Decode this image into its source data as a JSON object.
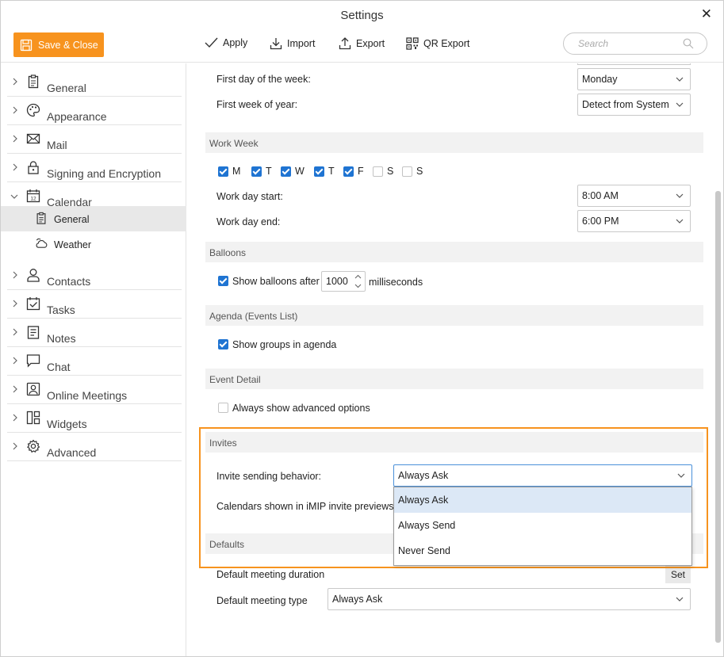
{
  "window": {
    "title": "Settings"
  },
  "toolbar": {
    "save_close": "Save & Close",
    "apply": "Apply",
    "import": "Import",
    "export": "Export",
    "qr_export": "QR Export",
    "search_placeholder": "Search"
  },
  "sidebar": {
    "items": [
      {
        "label": "General",
        "icon": "clipboard-icon"
      },
      {
        "label": "Appearance",
        "icon": "palette-icon"
      },
      {
        "label": "Mail",
        "icon": "envelope-icon"
      },
      {
        "label": "Signing and Encryption",
        "icon": "lock-icon"
      },
      {
        "label": "Calendar",
        "icon": "calendar-icon"
      },
      {
        "label": "Contacts",
        "icon": "person-icon"
      },
      {
        "label": "Tasks",
        "icon": "task-check-icon"
      },
      {
        "label": "Notes",
        "icon": "notes-icon"
      },
      {
        "label": "Chat",
        "icon": "chat-bubble-icon"
      },
      {
        "label": "Online Meetings",
        "icon": "meeting-icon"
      },
      {
        "label": "Widgets",
        "icon": "widgets-icon"
      },
      {
        "label": "Advanced",
        "icon": "gear-icon"
      }
    ],
    "calendar_sub": [
      {
        "label": "General",
        "icon": "clipboard-icon"
      },
      {
        "label": "Weather",
        "icon": "cloud-icon"
      }
    ],
    "calendar_day_number": "12"
  },
  "calendar_general": {
    "first_day_label": "First day of the week:",
    "first_day_value": "Monday",
    "first_week_label": "First week of year:",
    "first_week_value": "Detect from System",
    "work_week": {
      "title": "Work Week",
      "days": [
        {
          "label": "M",
          "checked": true
        },
        {
          "label": "T",
          "checked": true
        },
        {
          "label": "W",
          "checked": true
        },
        {
          "label": "T",
          "checked": true
        },
        {
          "label": "F",
          "checked": true
        },
        {
          "label": "S",
          "checked": false
        },
        {
          "label": "S",
          "checked": false
        }
      ],
      "start_label": "Work day start:",
      "start_value": "8:00 AM",
      "end_label": "Work day end:",
      "end_value": "6:00 PM"
    },
    "balloons": {
      "title": "Balloons",
      "show_label": "Show balloons after",
      "show_checked": true,
      "value": "1000",
      "unit": "milliseconds"
    },
    "agenda": {
      "title": "Agenda (Events List)",
      "groups_label": "Show groups in agenda",
      "groups_checked": true
    },
    "event_detail": {
      "title": "Event Detail",
      "advanced_label": "Always show advanced options",
      "advanced_checked": false
    },
    "invites": {
      "title": "Invites",
      "behavior_label": "Invite sending behavior:",
      "behavior_value": "Always Ask",
      "calendars_label": "Calendars shown in iMIP invite previews:",
      "options": [
        "Always Ask",
        "Always Send",
        "Never Send"
      ]
    },
    "defaults": {
      "title": "Defaults",
      "duration_label": "Default meeting duration",
      "set_button": "Set",
      "type_label": "Default meeting type",
      "type_value": "Always Ask"
    }
  },
  "colors": {
    "accent": "#f7931e",
    "checkbox": "#1f74d2",
    "selection": "#dce8f6"
  }
}
